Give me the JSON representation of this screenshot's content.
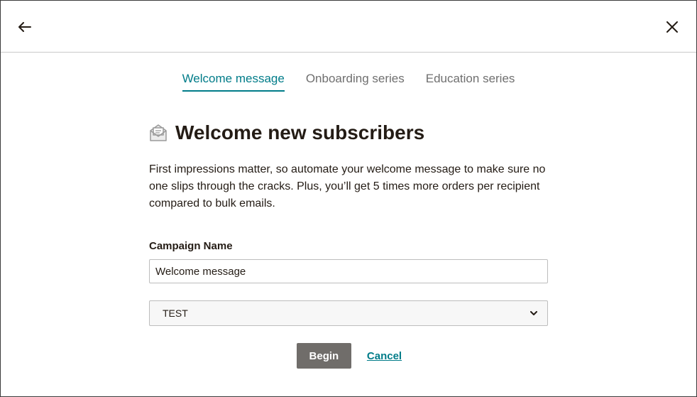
{
  "header": {
    "back_icon": "arrow-left-icon",
    "close_icon": "close-icon"
  },
  "tabs": [
    {
      "label": "Welcome message",
      "active": true
    },
    {
      "label": "Onboarding series",
      "active": false
    },
    {
      "label": "Education series",
      "active": false
    }
  ],
  "main": {
    "icon": "envelope-open-icon",
    "title": "Welcome new subscribers",
    "description": "First impressions matter, so automate your welcome message to make sure no one slips through the cracks. Plus, you’ll get 5 times more orders per recipient compared to bulk emails.",
    "campaign_name_label": "Campaign Name",
    "campaign_name_value": "Welcome message",
    "audience_select_value": "TEST",
    "begin_label": "Begin",
    "cancel_label": "Cancel"
  },
  "colors": {
    "accent": "#007c89",
    "button": "#706d6a",
    "text": "#241c15"
  }
}
